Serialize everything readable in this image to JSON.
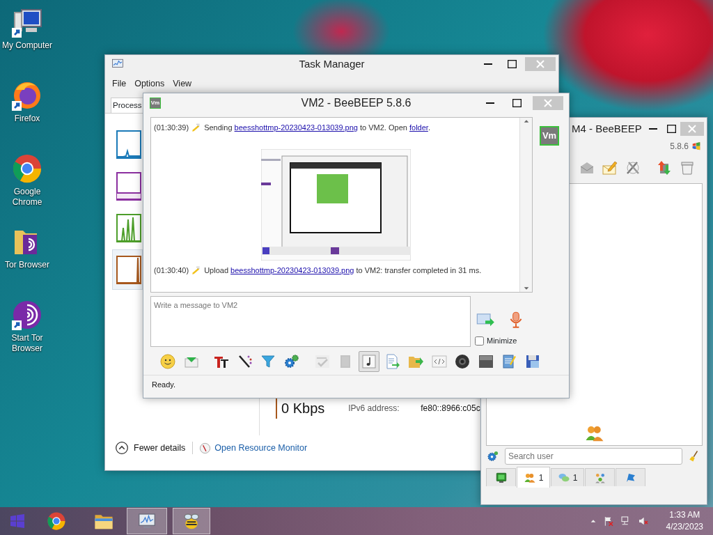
{
  "desktop_icons": [
    {
      "kind": "computer",
      "label": "My Computer"
    },
    {
      "kind": "firefox",
      "label": "Firefox"
    },
    {
      "kind": "chrome",
      "label": "Google Chrome"
    },
    {
      "kind": "tor_folder",
      "label": "Tor Browser"
    },
    {
      "kind": "tor",
      "label": "Start Tor Browser"
    }
  ],
  "task_manager": {
    "title": "Task Manager",
    "menu": [
      "File",
      "Options",
      "View"
    ],
    "tabs": [
      {
        "label": "Process",
        "selected": true
      }
    ],
    "graphs": [
      {
        "kind": "cpu",
        "color": "#1b7ab8",
        "selected": false
      },
      {
        "kind": "memory",
        "color": "#8b2fa0",
        "selected": false
      },
      {
        "kind": "disk",
        "color": "#4d9e2a",
        "selected": false
      },
      {
        "kind": "ethernet",
        "color": "#a7581d",
        "selected": true
      }
    ],
    "receive": "0 Kbps",
    "ipv6_label": "IPv6 address:",
    "ipv6_value": "fe80::8966:c05c",
    "fewer_details": "Fewer details",
    "resource_monitor": "Open Resource Monitor"
  },
  "beebeep_main": {
    "title": "M4 - BeeBEEP",
    "version": "5.8.6",
    "search": {
      "placeholder": "Search user"
    },
    "tabs": [
      {
        "kind": "computer",
        "selected": false
      },
      {
        "kind": "users",
        "count": "1",
        "selected": true
      },
      {
        "kind": "chats",
        "count": "1",
        "selected": false
      },
      {
        "kind": "groups",
        "selected": false
      },
      {
        "kind": "flag",
        "selected": false
      }
    ]
  },
  "chat_window": {
    "title": "VM2 - BeeBEEP 5.8.6",
    "title_icon": "Vm",
    "avatar": "Vm",
    "messages": [
      {
        "time": "(01:30:39)",
        "parts": [
          {
            "text": "Sending "
          },
          {
            "link": "beesshottmp-20230423-013039.png"
          },
          {
            "text": " to VM2. Open "
          },
          {
            "link": "folder"
          },
          {
            "text": "."
          }
        ]
      },
      {
        "time": "(01:30:40)",
        "parts": [
          {
            "text": "Upload "
          },
          {
            "link": "beesshottmp-20230423-013039.png"
          },
          {
            "text": " to VM2: transfer completed in 31 ms."
          }
        ]
      }
    ],
    "message_field": {
      "placeholder": "Write a message to VM2"
    },
    "minimize": {
      "label": "Minimize",
      "checked": false
    },
    "toolbar": [
      {
        "kind": "emoji",
        "on": false,
        "disabled": false
      },
      {
        "kind": "envelope",
        "on": false,
        "disabled": false
      },
      {
        "kind": "font",
        "on": false,
        "disabled": false
      },
      {
        "kind": "pen",
        "on": false,
        "disabled": false
      },
      {
        "kind": "funnel",
        "on": false,
        "disabled": false
      },
      {
        "kind": "gears",
        "on": false,
        "disabled": false
      },
      {
        "kind": "spellcheck",
        "on": false,
        "disabled": true
      },
      {
        "kind": "book",
        "on": false,
        "disabled": true
      },
      {
        "kind": "note",
        "on": true,
        "disabled": false
      },
      {
        "kind": "document",
        "on": false,
        "disabled": false
      },
      {
        "kind": "folder",
        "on": false,
        "disabled": false
      },
      {
        "kind": "code",
        "on": false,
        "disabled": false
      },
      {
        "kind": "camera",
        "on": false,
        "disabled": false
      },
      {
        "kind": "screen",
        "on": false,
        "disabled": false
      },
      {
        "kind": "notepad",
        "on": false,
        "disabled": false
      },
      {
        "kind": "floppy",
        "on": false,
        "disabled": false
      }
    ],
    "status": "Ready."
  },
  "taskbar": {
    "apps": [
      {
        "kind": "chrome",
        "active": false
      },
      {
        "kind": "explorer",
        "active": false
      },
      {
        "kind": "taskmgr",
        "active": true
      },
      {
        "kind": "bee",
        "active": true
      }
    ],
    "clock": {
      "time": "1:33 AM",
      "date": "4/23/2023"
    }
  }
}
